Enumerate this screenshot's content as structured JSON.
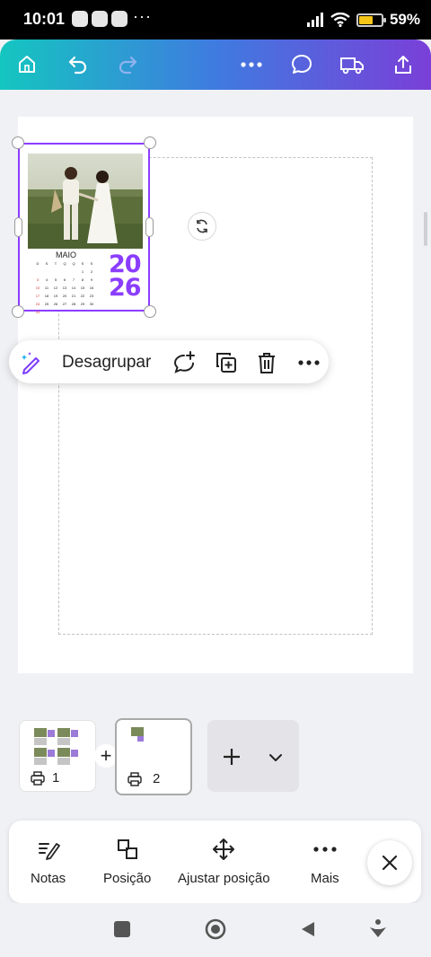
{
  "status_bar": {
    "time": "10:01",
    "more_dots": "···",
    "battery": "59%",
    "battery_level": 0.59,
    "app_icons": [
      "whatsapp-icon",
      "compass-icon",
      "camera-icon"
    ]
  },
  "toolbar": {
    "icons": [
      "home-icon",
      "undo-icon",
      "redo-icon",
      "more-icon",
      "comment-icon",
      "delivery-truck-icon",
      "share-icon"
    ]
  },
  "design": {
    "month": "MAIO",
    "year_top": "20",
    "year_bottom": "26",
    "weekdays": [
      "D",
      "S",
      "T",
      "Q",
      "Q",
      "S",
      "S"
    ],
    "weeks": [
      [
        "",
        "",
        "",
        "",
        "",
        "1",
        "2"
      ],
      [
        "3",
        "4",
        "5",
        "6",
        "7",
        "8",
        "9"
      ],
      [
        "10",
        "11",
        "12",
        "13",
        "14",
        "15",
        "16"
      ],
      [
        "17",
        "18",
        "19",
        "20",
        "21",
        "22",
        "23"
      ],
      [
        "24",
        "25",
        "26",
        "27",
        "28",
        "29",
        "30"
      ],
      [
        "31",
        "",
        "",
        "",
        "",
        "",
        ""
      ]
    ]
  },
  "context_menu": {
    "label": "Desagrupar",
    "icons": [
      "magic-edit-icon",
      "add-comment-icon",
      "duplicate-icon",
      "trash-icon",
      "more-icon"
    ]
  },
  "pages": {
    "items": [
      {
        "label": "1",
        "selected": false
      },
      {
        "label": "2",
        "selected": true
      }
    ],
    "add_symbol": "+"
  },
  "bottom_bar": {
    "items": [
      {
        "label": "Notas",
        "icon": "notes-icon"
      },
      {
        "label": "Posição",
        "icon": "position-icon"
      },
      {
        "label": "Ajustar posição",
        "icon": "move-icon"
      },
      {
        "label": "Mais",
        "icon": "more-icon"
      }
    ]
  },
  "colors": {
    "accent": "#8b3dff",
    "gradient_start": "#14c6c0",
    "gradient_end": "#7a3fd8"
  }
}
